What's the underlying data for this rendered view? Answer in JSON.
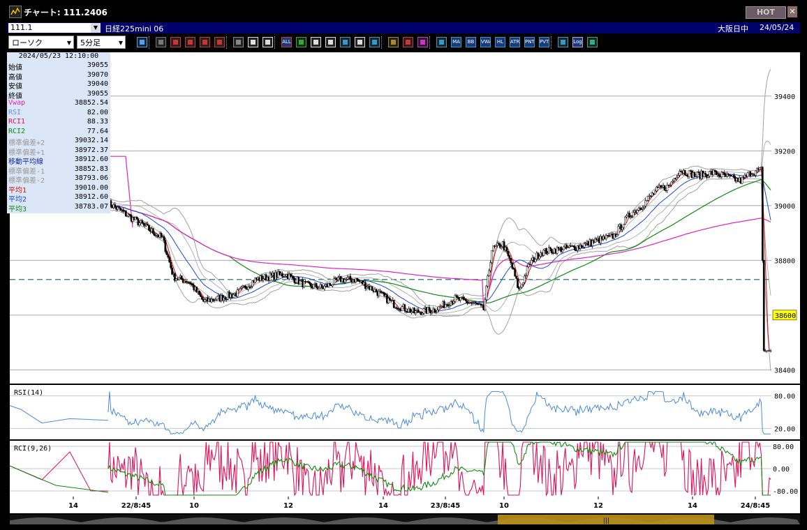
{
  "window": {
    "title": "チャート: 111.2406",
    "hot_label": "HOT",
    "close_glyph": "✕"
  },
  "infobar": {
    "symbol": "111.1",
    "instrument": "日経225mini 06",
    "session": "大阪日中",
    "date": "24/05/24"
  },
  "toolbar": {
    "chart_type": "ローソク",
    "interval": "5分足",
    "buttons": [
      {
        "name": "zoom-icon",
        "label": "",
        "color": "#4aa3ff"
      },
      {
        "name": "crosshair-icon",
        "label": "",
        "color": "#777"
      },
      {
        "name": "scroll-left-icon",
        "label": "",
        "color": "#c33"
      },
      {
        "name": "search-icon",
        "label": "",
        "color": "#c33"
      },
      {
        "name": "grid-icon",
        "label": "",
        "color": "#c33"
      },
      {
        "name": "trend-icon",
        "label": "",
        "color": "#c33"
      },
      {
        "name": "eraser-icon",
        "label": "",
        "color": "#888"
      },
      {
        "name": "candle-icon",
        "label": "",
        "color": "#ddd"
      },
      {
        "name": "candle-red-icon",
        "label": "",
        "color": "#ddd"
      },
      {
        "name": "all-icon",
        "label": "ALL",
        "color": "#c33"
      },
      {
        "name": "pencil-icon",
        "label": "",
        "color": "#3a3"
      },
      {
        "name": "line-tool-icon",
        "label": "",
        "color": "#ddd"
      },
      {
        "name": "pointer-icon",
        "label": "",
        "color": "#ddd"
      },
      {
        "name": "fill-icon",
        "label": "",
        "color": "#39c"
      },
      {
        "name": "list-icon",
        "label": "",
        "color": "#ddd"
      },
      {
        "name": "trash-icon",
        "label": "",
        "color": "#39c"
      },
      {
        "name": "settings-icon",
        "label": "",
        "color": "#a83"
      },
      {
        "name": "brush-icon",
        "label": "",
        "color": "#c33"
      },
      {
        "name": "palette-icon",
        "label": "",
        "color": "#c3c"
      },
      {
        "name": "indicator-icon",
        "label": "",
        "color": "#39c"
      },
      {
        "name": "ma-button",
        "label": "MA",
        "color": "#39c"
      },
      {
        "name": "bb-button",
        "label": "BB",
        "color": "#39c"
      },
      {
        "name": "vwap-button",
        "label": "VWAP",
        "color": "#39c"
      },
      {
        "name": "hl-button",
        "label": "HL",
        "color": "#39c"
      },
      {
        "name": "atr-button",
        "label": "ATR",
        "color": "#39c"
      },
      {
        "name": "pnt-button",
        "label": "PNT",
        "color": "#39c"
      },
      {
        "name": "pvt-button",
        "label": "PVT",
        "color": "#39c"
      },
      {
        "name": "window-button",
        "label": "",
        "color": "#39c"
      },
      {
        "name": "log-button",
        "label": "Log",
        "color": "#c9c"
      },
      {
        "name": "export-icon",
        "label": "",
        "color": "#3a8"
      }
    ]
  },
  "data_panel": {
    "datetime": "2024/05/23  12:10:00",
    "rows": [
      {
        "label": "始値",
        "value": "39055",
        "color": "#000000"
      },
      {
        "label": "高値",
        "value": "39070",
        "color": "#000000"
      },
      {
        "label": "安値",
        "value": "39040",
        "color": "#000000"
      },
      {
        "label": "終値",
        "value": "39055",
        "color": "#000000"
      },
      {
        "label": "Vwap",
        "value": "38852.54",
        "color": "#e020c0"
      },
      {
        "label": "RSI",
        "value": "82.00",
        "color": "#6a8fd8"
      },
      {
        "label": "RCI1",
        "value": "88.33",
        "color": "#e0105a"
      },
      {
        "label": "RCI2",
        "value": "77.64",
        "color": "#108a10"
      },
      {
        "label": "標準偏差+2",
        "value": "39032.14",
        "color": "#9a9a9a"
      },
      {
        "label": "標準偏差+1",
        "value": "38972.37",
        "color": "#9a9a9a"
      },
      {
        "label": "移動平均線",
        "value": "38912.60",
        "color": "#1a2aa0"
      },
      {
        "label": "標準偏差-1",
        "value": "38852.83",
        "color": "#9a9a9a"
      },
      {
        "label": "標準偏差-2",
        "value": "38793.06",
        "color": "#9a9a9a"
      },
      {
        "label": "平均1",
        "value": "39010.00",
        "color": "#d01010"
      },
      {
        "label": "平均2",
        "value": "38912.60",
        "color": "#1a4ad0"
      },
      {
        "label": "平均3",
        "value": "38783.07",
        "color": "#108a10"
      }
    ]
  },
  "chart_data": {
    "type": "candlestick",
    "main": {
      "ylim": [
        38350,
        39560
      ],
      "yticks": [
        38400,
        38600,
        38800,
        39000,
        39200,
        39400
      ],
      "ytick_labels": [
        "38400",
        "38600",
        "38800",
        "39000",
        "39200",
        "39400"
      ],
      "current_price_label": "38600",
      "dashed_level": 38730,
      "candle_colors": {
        "up": "#ffffff",
        "down": "#000000",
        "outline": "#000000"
      }
    },
    "x_labels": [
      "14",
      "22/8:45",
      "10",
      "12",
      "14",
      "23/8:45",
      "10",
      "12",
      "14",
      "24/8:45"
    ],
    "rsi": {
      "title": "RSI(14)",
      "ylim": [
        0,
        100
      ],
      "ticks": [
        80,
        20
      ],
      "tick_labels": [
        "80.00",
        "20.00"
      ]
    },
    "rci": {
      "title": "RCI(9,26)",
      "ylim": [
        -100,
        100
      ],
      "ticks": [
        80,
        0,
        -80
      ],
      "tick_labels": [
        "80.00",
        "0.00",
        "-80.00"
      ]
    }
  },
  "colors": {
    "chart_bg": "#ffffff",
    "sma": "#1a4ad0",
    "bands": "#a0a0a0",
    "vwap": "#e020c0",
    "avg1": "#d01010",
    "avg3": "#108a10",
    "rsi": "#4a8ad8",
    "rci1": "#e0105a",
    "rci2": "#108a10",
    "dashed": "#106060",
    "price_label_bg": "#ffff00",
    "scroll_thumb": "#b8901a"
  }
}
